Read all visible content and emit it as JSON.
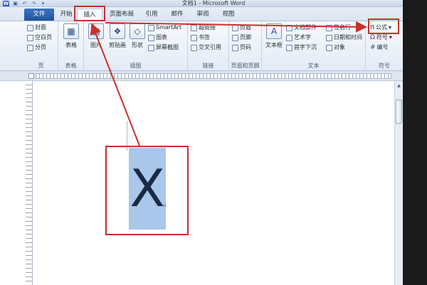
{
  "window": {
    "title": "文档1 - Microsoft Word",
    "controls": [
      "–",
      "□",
      "✕"
    ]
  },
  "tabs": [
    {
      "label": "文件"
    },
    {
      "label": "开始"
    },
    {
      "label": "插入"
    },
    {
      "label": "页面布局"
    },
    {
      "label": "引用"
    },
    {
      "label": "邮件"
    },
    {
      "label": "审阅"
    },
    {
      "label": "视图"
    }
  ],
  "ribbon": {
    "pages": {
      "label": "页",
      "items": [
        "封面",
        "空白页",
        "分页"
      ]
    },
    "tables": {
      "label": "表格",
      "button": "表格"
    },
    "illustrations": {
      "label": "插图",
      "buttons": [
        "图片",
        "剪贴画",
        "形状"
      ],
      "items": [
        "SmartArt",
        "图表",
        "屏幕截图"
      ]
    },
    "links": {
      "label": "链接",
      "items": [
        "超链接",
        "书签",
        "交叉引用"
      ]
    },
    "header_footer": {
      "label": "页眉和页脚",
      "items": [
        "页眉",
        "页脚",
        "页码"
      ]
    },
    "text": {
      "label": "文本",
      "button": "文本框",
      "items": [
        "文档部件",
        "艺术字",
        "首字下沉",
        "签名行",
        "日期和时间",
        "对象"
      ]
    },
    "symbols": {
      "label": "符号",
      "items": [
        "公式",
        "符号",
        "编号"
      ]
    }
  },
  "document": {
    "content": "X",
    "paragraph_mark": "↵"
  },
  "colors": {
    "accent": "#2b5fad",
    "annotation": "#c8302c",
    "selection": "#a8c7ea"
  },
  "icons": {
    "pi": "π",
    "omega": "Ω",
    "numbering": "#"
  }
}
